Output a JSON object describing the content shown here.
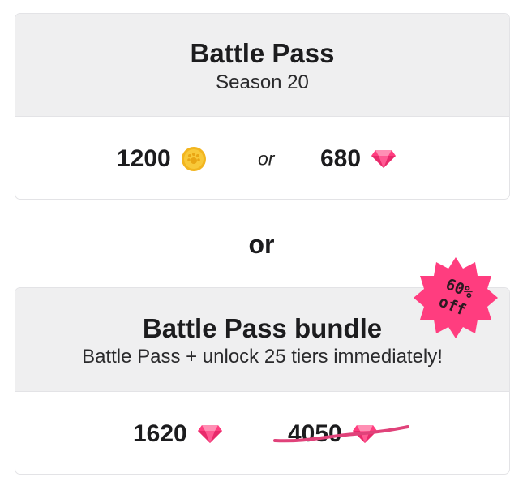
{
  "battle_pass": {
    "title": "Battle Pass",
    "subtitle": "Season 20",
    "coin_price": "1200",
    "separator": "or",
    "gem_price": "680"
  },
  "divider_or": "or",
  "bundle": {
    "title": "Battle Pass bundle",
    "subtitle": "Battle Pass + unlock 25 tiers immediately!",
    "gem_price": "1620",
    "original_price": "4050",
    "badge_line1": "60%",
    "badge_line2": "off"
  },
  "colors": {
    "gem": "#ff3d7f",
    "coin": "#f5c02e",
    "badge": "#ff3d7f",
    "strike": "#e0427a"
  },
  "icons": {
    "coin": "coin-icon",
    "gem": "gem-icon"
  }
}
